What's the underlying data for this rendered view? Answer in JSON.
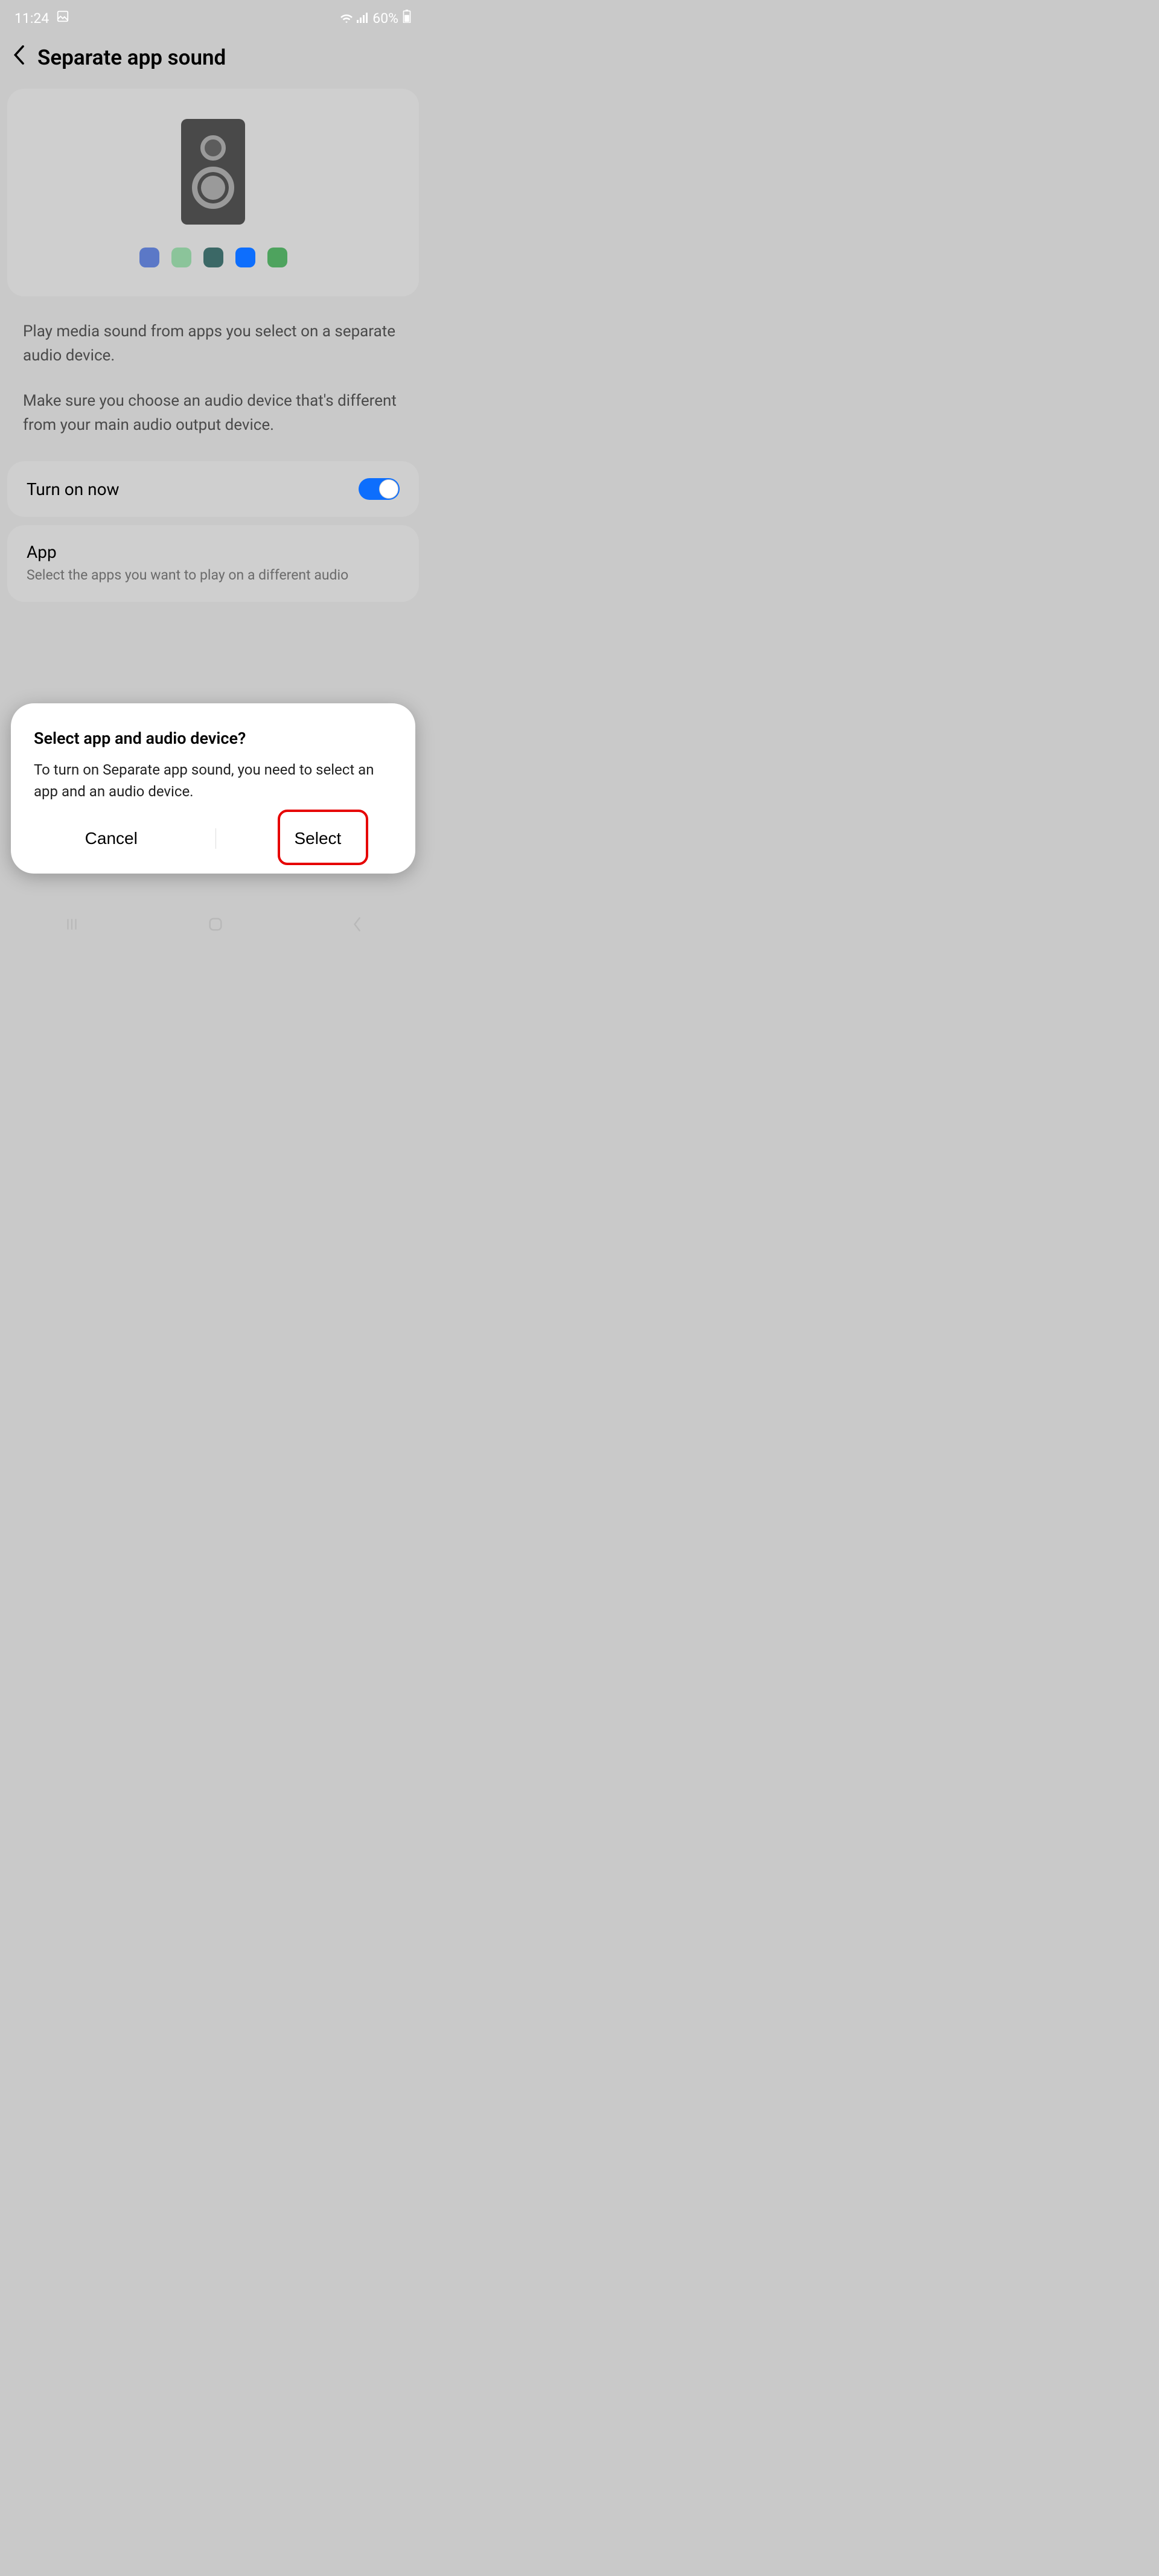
{
  "status": {
    "time": "11:24",
    "battery": "60%"
  },
  "header": {
    "title": "Separate app sound"
  },
  "hero": {
    "dot_colors": [
      "#5b78c7",
      "#8bc49a",
      "#3b6866",
      "#0d6efd",
      "#4ea35e"
    ]
  },
  "description": {
    "p1": "Play media sound from apps you select on a separate audio device.",
    "p2": "Make sure you choose an audio device that's different from your main audio output device."
  },
  "toggle": {
    "label": "Turn on now",
    "state": "on"
  },
  "app_section": {
    "title": "App",
    "desc": "Select the apps you want to play on a different audio"
  },
  "dialog": {
    "title": "Select app and audio device?",
    "body": "To turn on Separate app sound, you need to select an app and an audio device.",
    "cancel": "Cancel",
    "select": "Select"
  }
}
